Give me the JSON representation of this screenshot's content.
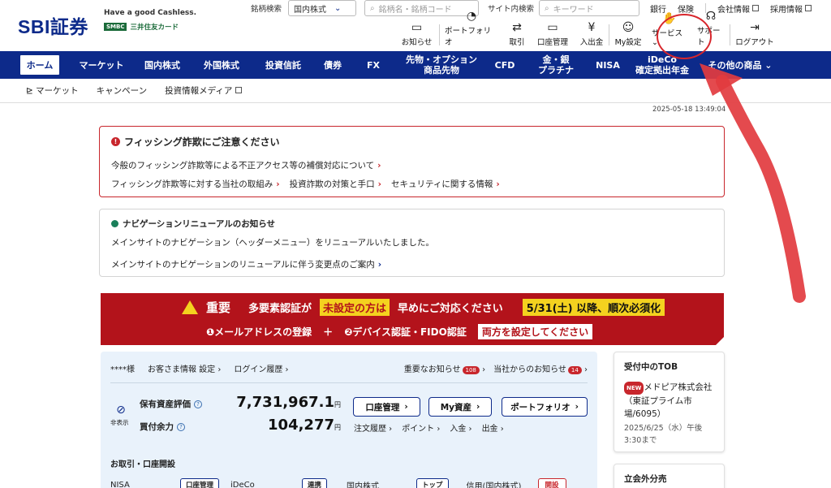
{
  "header": {
    "logo": "SBI証券",
    "tagline": "Have a good Cashless.",
    "smbc_badge": "SMBC",
    "smbc_text": "三井住友カード",
    "stock_search_label": "銘柄検索",
    "stock_search_select": "国内株式",
    "stock_search_placeholder": "銘柄名・銘柄コード",
    "site_search_label": "サイト内検索",
    "site_search_placeholder": "キーワード",
    "top_links": [
      "銀行",
      "保険",
      "会社情報",
      "採用情報"
    ]
  },
  "toolbar": {
    "items": [
      {
        "label": "お知らせ",
        "icon": "chat-icon"
      },
      {
        "label": "ポートフォリオ",
        "icon": "pie-chart-icon"
      },
      {
        "label": "取引",
        "icon": "arrows-icon"
      },
      {
        "label": "口座管理",
        "icon": "card-icon"
      },
      {
        "label": "入出金",
        "icon": "yen-icon"
      },
      {
        "label": "My設定",
        "icon": "user-gear-icon"
      },
      {
        "label": "サービス",
        "icon": "service-icon"
      },
      {
        "label": "サポート",
        "icon": "headset-icon"
      },
      {
        "label": "ログアウト",
        "icon": "logout-icon"
      }
    ]
  },
  "nav": {
    "items": [
      "ホーム",
      "マーケット",
      "国内株式",
      "外国株式",
      "投資信託",
      "債券",
      "FX",
      "先物・オプション\n商品先物",
      "CFD",
      "金・銀\nプラチナ",
      "NISA",
      "iDeCo\n確定拠出年金",
      "その他の商品"
    ]
  },
  "subnav": {
    "items": [
      "マーケット",
      "キャンペーン",
      "投資情報メディア"
    ]
  },
  "timestamp": "2025-05-18 13:49:04",
  "phishing_alert": {
    "title": "フィッシング詐欺にご注意ください",
    "link1": "今般のフィッシング詐欺等による不正アクセス等の補償対応について",
    "link2": "フィッシング詐欺等に対する当社の取組み",
    "link3": "投資詐欺の対策と手口",
    "link4": "セキュリティに関する情報"
  },
  "nav_notice": {
    "title": "ナビゲーションリニューアルのお知らせ",
    "text": "メインサイトのナビゲーション（ヘッダーメニュー）をリニューアルいたしました。",
    "link": "メインサイトのナビゲーションのリニューアルに伴う変更点のご案内"
  },
  "banner": {
    "important": "重要",
    "text1": "多要素認証が",
    "highlight1": "未設定の方は",
    "text2": "早めにご対応ください",
    "deadline": "5/31(土) 以降、順次必須化",
    "step1": "❶メールアドレスの登録",
    "plus": "＋",
    "step2": "❷デバイス認証・FIDO認証",
    "both": "両方を設定してください"
  },
  "account": {
    "customer": "****様",
    "customer_info": "お客さま情報 設定",
    "login_history": "ログイン履歴",
    "important_notice": "重要なお知らせ",
    "important_count": "108",
    "company_notice": "当社からのお知らせ",
    "company_count": "14",
    "hide_label": "非表示",
    "assets_label": "保有資産評価",
    "assets_value": "7,731,967.1",
    "buying_power_label": "買付余力",
    "buying_power_value": "104,277",
    "yen": "円",
    "btn_account": "口座管理",
    "btn_my_assets": "My資産",
    "btn_portfolio": "ポートフォリオ",
    "sub_links": [
      "注文履歴",
      "ポイント",
      "入金",
      "出金"
    ],
    "section_title": "お取引・口座開設",
    "row": {
      "nisa": "NISA",
      "nisa_btn": "口座管理",
      "ideco": "iDeCo",
      "ideco_btn": "連携",
      "domestic": "国内株式",
      "domestic_btn": "トップ",
      "margin": "信用(国内株式)",
      "margin_btn": "開設"
    }
  },
  "tob_card": {
    "title": "受付中のTOB",
    "new_badge": "NEW",
    "item": "メドピア株式会社（東証プライム市場/6095）",
    "date": "2025/6/25（水）午後3:30まで"
  },
  "offmarket_card": {
    "title": "立会外分売"
  },
  "colors": {
    "brand": "#0d2a8a",
    "alert": "#c8262c",
    "banner": "#b3131b",
    "annotation": "#e23b3f"
  }
}
